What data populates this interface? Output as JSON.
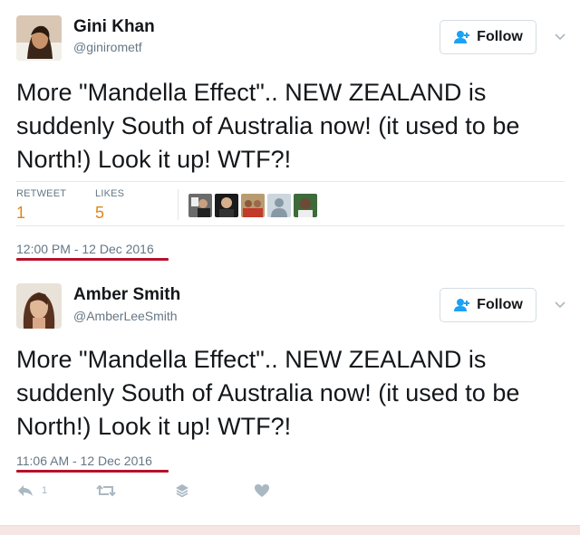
{
  "tweets": [
    {
      "name": "Gini Khan",
      "handle": "@ginirometf",
      "follow_label": "Follow",
      "text": "More \"Mandella Effect\".. NEW ZEALAND is suddenly South of Australia now! (it used to be North!) Look it up! WTF?!",
      "stats": {
        "retweet_label": "RETWEET",
        "retweet_count": "1",
        "likes_label": "LIKES",
        "likes_count": "5"
      },
      "timestamp": "12:00 PM - 12 Dec 2016"
    },
    {
      "name": "Amber Smith",
      "handle": "@AmberLeeSmith",
      "follow_label": "Follow",
      "text": "More \"Mandella Effect\".. NEW ZEALAND is suddenly South of Australia now! (it used to be North!) Look it up! WTF?!",
      "timestamp": "11:06 AM - 12 Dec 2016",
      "actions": {
        "reply_count": "1"
      }
    }
  ],
  "colors": {
    "stat_value": "#e0861a",
    "underline": "#b7102a",
    "muted": "#657786"
  }
}
